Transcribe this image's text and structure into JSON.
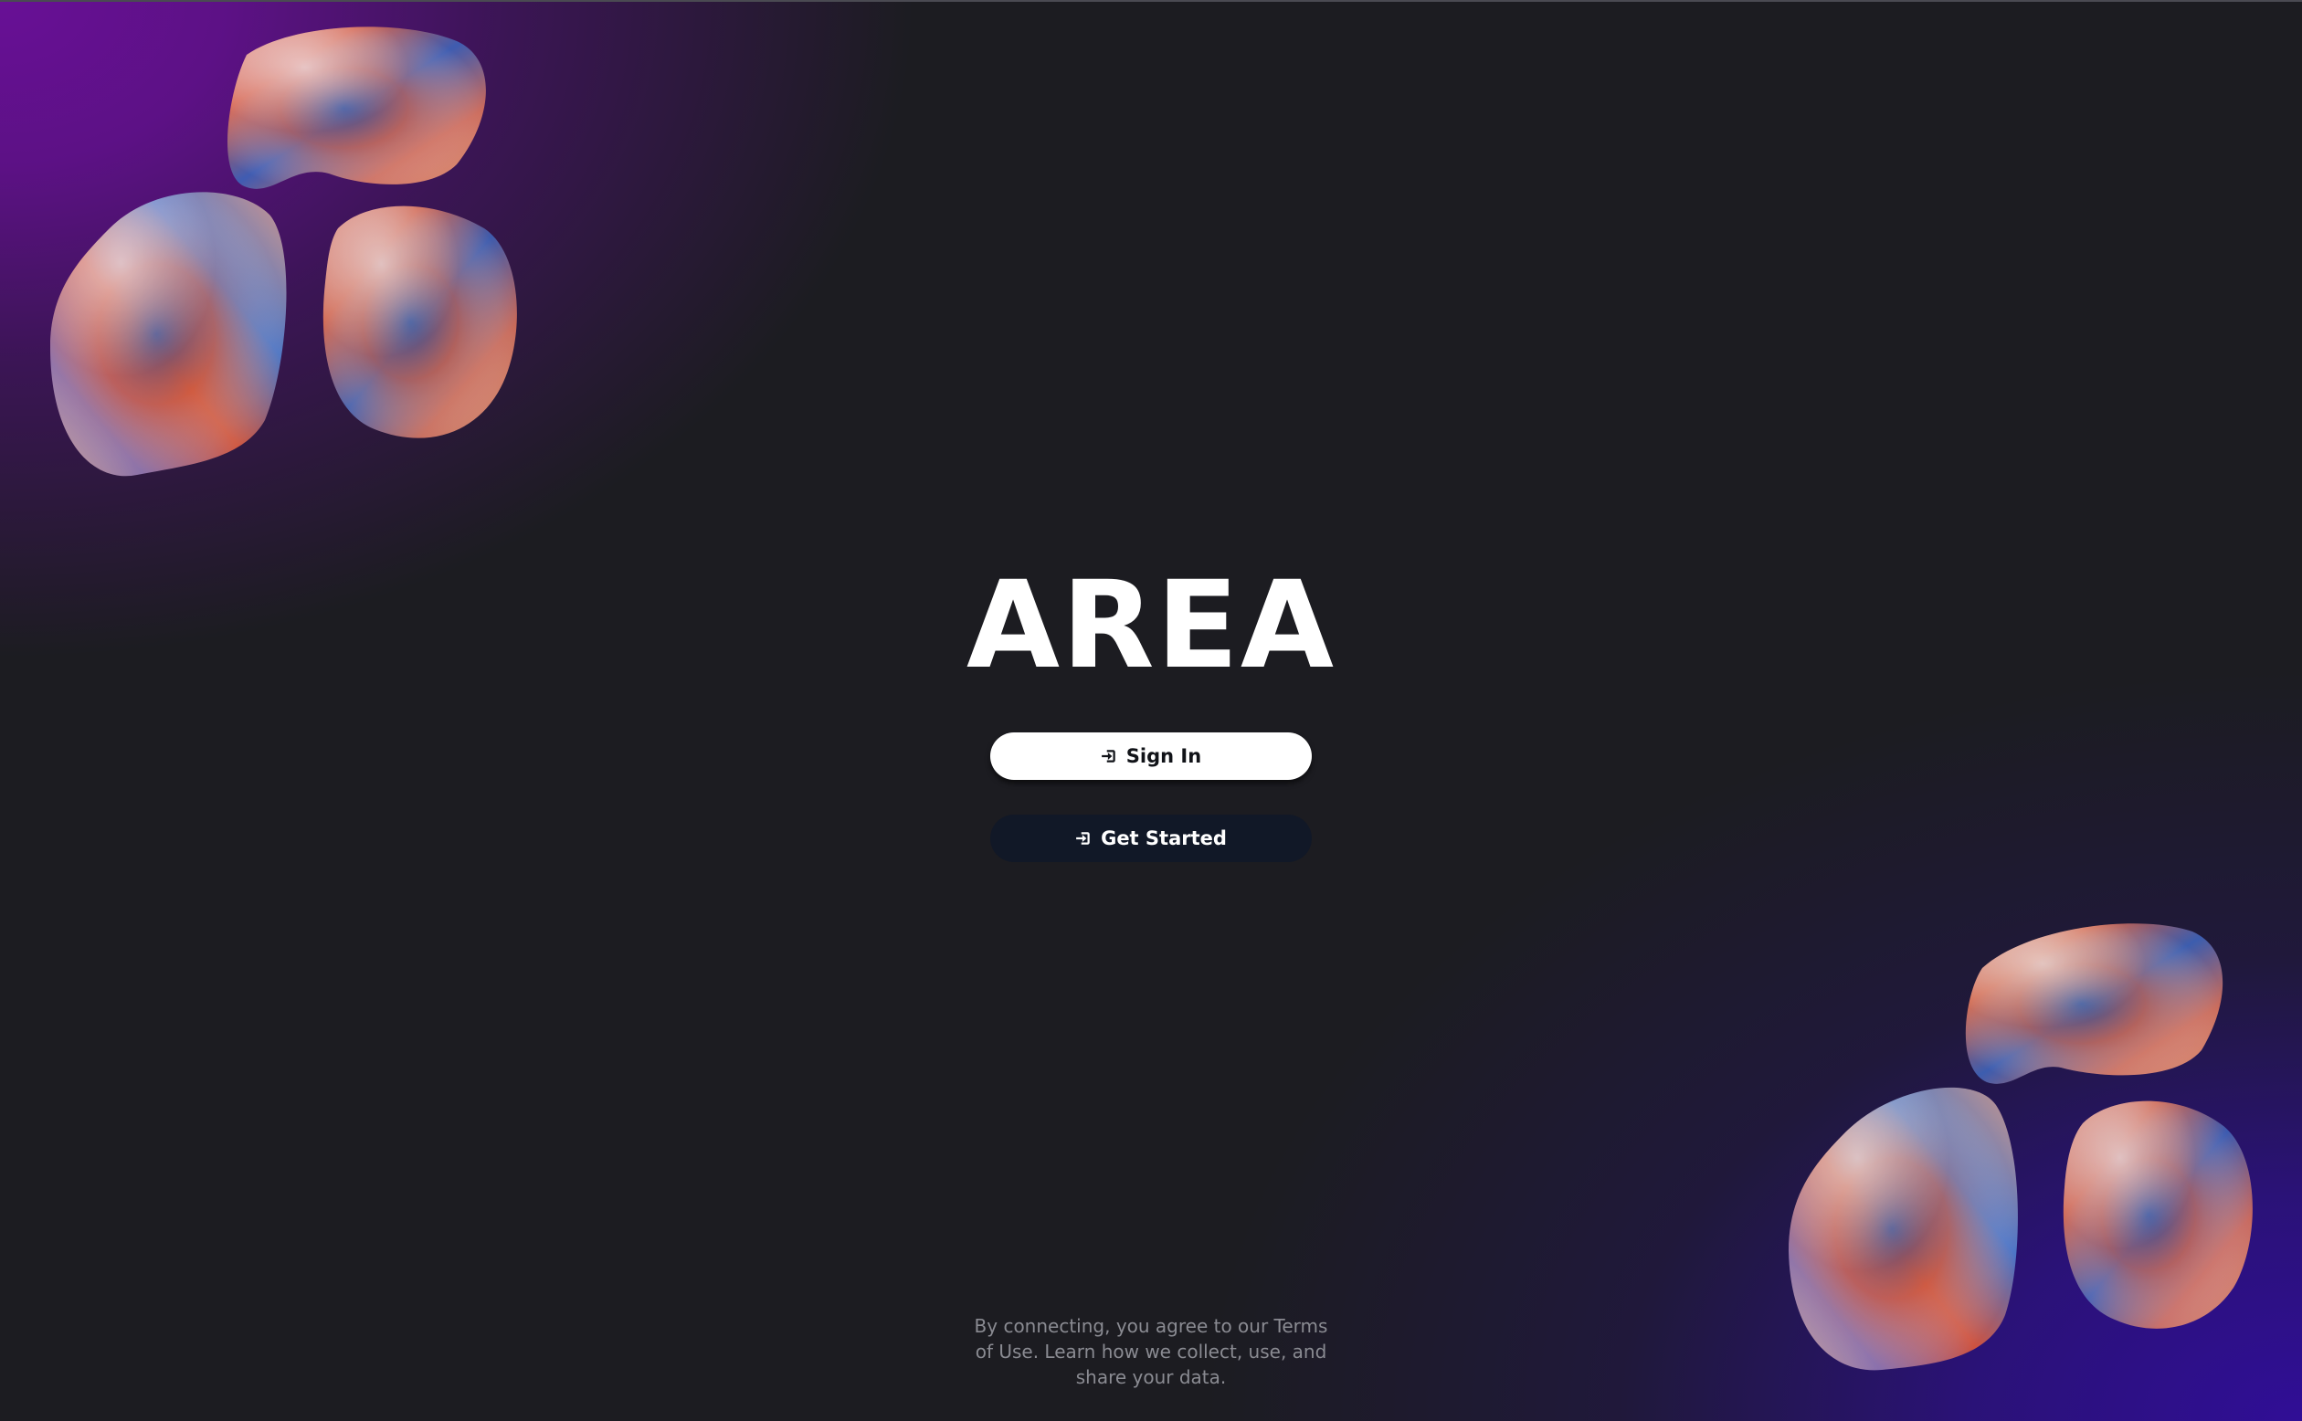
{
  "app": {
    "title": "AREA"
  },
  "actions": {
    "sign_in_label": "Sign In",
    "sign_in_icon": "sign-in-icon",
    "get_started_label": "Get Started",
    "get_started_icon": "sign-in-icon"
  },
  "footer": {
    "legal_text": "By connecting, you agree to our Terms of Use. Learn how we collect, use, and share your data."
  },
  "colors": {
    "background": "#1c1c21",
    "gradient_top_left": "#68108f",
    "gradient_bottom_right": "#300e96",
    "primary_button_bg": "#ffffff",
    "secondary_button_bg": "#111827",
    "legal_text": "#8a8b92"
  }
}
